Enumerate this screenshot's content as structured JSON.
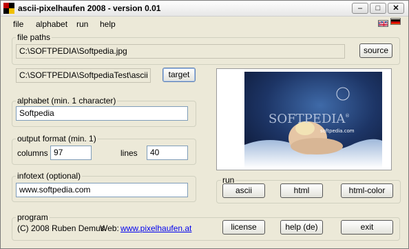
{
  "window": {
    "title": "ascii-pixelhaufen 2008 - version 0.01",
    "controls": {
      "minimize": "‒",
      "maximize": "□",
      "close": "✕"
    }
  },
  "menu": [
    "file",
    "alphabet",
    "run",
    "help"
  ],
  "file_paths": {
    "legend": "file paths",
    "source_path": "C:\\SOFTPEDIA\\Softpedia.jpg",
    "source_button": "source",
    "target_path": "C:\\SOFTPEDIA\\SoftpediaTest\\ascii",
    "target_button": "target"
  },
  "alphabet": {
    "legend": "alphabet (min. 1 character)",
    "value": "Softpedia"
  },
  "output_format": {
    "legend": "output format (min. 1)",
    "columns_label": "columns",
    "columns_value": "97",
    "lines_label": "lines",
    "lines_value": "40"
  },
  "infotext": {
    "legend": "infotext (optional)",
    "value": "www.softpedia.com"
  },
  "preview": {
    "watermark": "SOFTPEDIA",
    "trademark": "®",
    "tagline": "softpedia.com"
  },
  "run": {
    "legend": "run",
    "buttons": [
      "ascii",
      "html",
      "html-color"
    ]
  },
  "program": {
    "legend": "program",
    "copyright": "(C) 2008 Ruben Demus",
    "web_label": "Web:",
    "web_link": "www.pixelhaufen.at",
    "buttons": [
      "license",
      "help (de)",
      "exit"
    ]
  },
  "colors": {
    "window_bg": "#ece9d8",
    "accent_border": "#7f9db9",
    "link": "#0000ee",
    "icon_red": "#c00000",
    "icon_yellow": "#f0c000",
    "icon_black": "#000000"
  }
}
